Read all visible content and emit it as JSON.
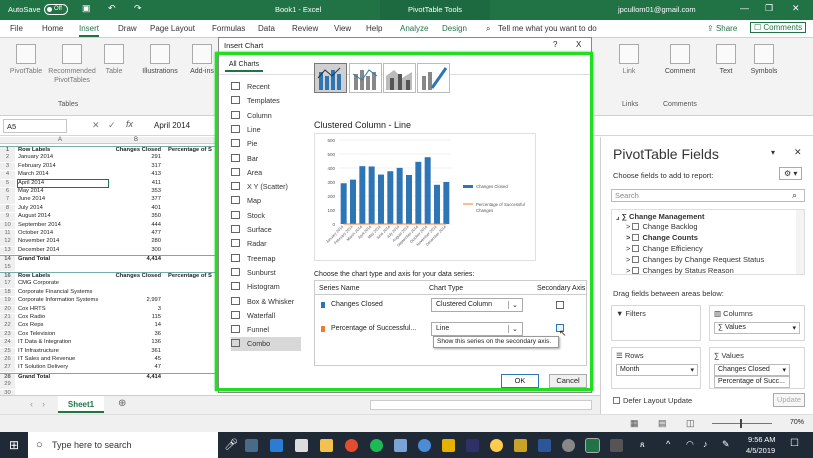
{
  "titlebar": {
    "autosave": "AutoSave",
    "toggle": "Off",
    "doc": "Book1 - Excel",
    "tools": "PivotTable Tools",
    "user": "jpcullom01@gmail.com"
  },
  "tabs": [
    "File",
    "Home",
    "Insert",
    "Draw",
    "Page Layout",
    "Formulas",
    "Data",
    "Review",
    "View",
    "Help",
    "Analyze",
    "Design"
  ],
  "active_tab": "Insert",
  "tellme": "Tell me what you want to do",
  "share": "Share",
  "comments": "Comments",
  "ribbon": {
    "pivottable": "PivotTable",
    "recommended": "Recommended PivotTables",
    "table": "Table",
    "tables_group": "Tables",
    "illustrations": "Illustrations",
    "addins": "Add-ins",
    "link": "Link",
    "comment": "Comment",
    "text": "Text",
    "symbols": "Symbols",
    "links_group": "Links",
    "comments_group": "Comments"
  },
  "formula": {
    "cell": "A5",
    "value": "April 2014"
  },
  "grid": {
    "col_a": "A",
    "col_b": "B",
    "rows": [
      {
        "n": "1",
        "a": "Row Labels",
        "b": "Changes Closed",
        "c": "Percentage of S",
        "bold": true
      },
      {
        "n": "2",
        "a": "January 2014",
        "b": "291",
        "c": ""
      },
      {
        "n": "3",
        "a": "February 2014",
        "b": "317",
        "c": ""
      },
      {
        "n": "4",
        "a": "March 2014",
        "b": "413",
        "c": ""
      },
      {
        "n": "5",
        "a": "April 2014",
        "b": "411",
        "c": ""
      },
      {
        "n": "6",
        "a": "May 2014",
        "b": "353",
        "c": ""
      },
      {
        "n": "7",
        "a": "June 2014",
        "b": "377",
        "c": ""
      },
      {
        "n": "8",
        "a": "July 2014",
        "b": "401",
        "c": ""
      },
      {
        "n": "9",
        "a": "August 2014",
        "b": "350",
        "c": ""
      },
      {
        "n": "10",
        "a": "September 2014",
        "b": "444",
        "c": ""
      },
      {
        "n": "11",
        "a": "October 2014",
        "b": "477",
        "c": ""
      },
      {
        "n": "12",
        "a": "November 2014",
        "b": "280",
        "c": ""
      },
      {
        "n": "13",
        "a": "December 2014",
        "b": "300",
        "c": ""
      },
      {
        "n": "14",
        "a": "Grand Total",
        "b": "4,414",
        "c": "",
        "bold": true
      },
      {
        "n": "15",
        "a": "",
        "b": "",
        "c": ""
      },
      {
        "n": "16",
        "a": "Row Labels",
        "b": "Changes Closed",
        "c": "Percentage of S",
        "bold": true
      },
      {
        "n": "17",
        "a": "CMG Corporate",
        "b": "",
        "c": ""
      },
      {
        "n": "18",
        "a": "Corporate Financial Systems",
        "b": "",
        "c": ""
      },
      {
        "n": "19",
        "a": "Corporate Information Systems",
        "b": "2,997",
        "c": ""
      },
      {
        "n": "20",
        "a": "Cox HRTS",
        "b": "3",
        "c": ""
      },
      {
        "n": "21",
        "a": "Cox Radio",
        "b": "115",
        "c": ""
      },
      {
        "n": "22",
        "a": "Cox Reps",
        "b": "14",
        "c": ""
      },
      {
        "n": "23",
        "a": "Cox Television",
        "b": "36",
        "c": ""
      },
      {
        "n": "24",
        "a": "IT Data & Integration",
        "b": "136",
        "c": ""
      },
      {
        "n": "25",
        "a": "IT Infrastructure",
        "b": "361",
        "c": ""
      },
      {
        "n": "26",
        "a": "IT Sales and Revenue",
        "b": "45",
        "c": ""
      },
      {
        "n": "27",
        "a": "IT Solution Delivery",
        "b": "47",
        "c": ""
      },
      {
        "n": "28",
        "a": "Grand Total",
        "b": "4,414",
        "c": "",
        "bold": true
      },
      {
        "n": "29",
        "a": "",
        "b": "",
        "c": ""
      },
      {
        "n": "30",
        "a": "",
        "b": "",
        "c": ""
      }
    ]
  },
  "sheet_tab": "Sheet1",
  "dialog": {
    "title": "Insert Chart",
    "tab": "All Charts",
    "types": [
      "Recent",
      "Templates",
      "Column",
      "Line",
      "Pie",
      "Bar",
      "Area",
      "X Y (Scatter)",
      "Map",
      "Stock",
      "Surface",
      "Radar",
      "Treemap",
      "Sunburst",
      "Histogram",
      "Box & Whisker",
      "Waterfall",
      "Funnel",
      "Combo"
    ],
    "active_type": "Combo",
    "chart_title": "Clustered Column - Line",
    "instruction": "Choose the chart type and axis for your data series:",
    "headers": {
      "name": "Series Name",
      "type": "Chart Type",
      "axis": "Secondary Axis"
    },
    "series": [
      {
        "name": "Changes Closed",
        "type": "Clustered Column",
        "color": "#2e75b6"
      },
      {
        "name": "Percentage of Successful...",
        "type": "Line",
        "color": "#ed7d31"
      }
    ],
    "tooltip": "Show this series on the secondary axis.",
    "ok": "OK",
    "cancel": "Cancel",
    "help": "?",
    "close": "X"
  },
  "chart_data": {
    "type": "bar",
    "categories": [
      "January 2014",
      "February 2014",
      "March 2014",
      "April 2014",
      "May 2014",
      "June 2014",
      "July 2014",
      "August 2014",
      "September 2014",
      "October 2014",
      "November 2014",
      "December 2014"
    ],
    "series": [
      {
        "name": "Changes Closed",
        "values": [
          291,
          317,
          413,
          411,
          353,
          377,
          401,
          350,
          444,
          477,
          280,
          300
        ]
      },
      {
        "name": "Percentage of Successful Changes",
        "values": [
          0,
          0,
          0,
          0,
          0,
          0,
          0,
          0,
          0,
          0,
          0,
          0
        ]
      }
    ],
    "ylim": [
      0,
      600
    ],
    "yticks": [
      "600",
      "500",
      "400",
      "300",
      "200",
      "100",
      "0"
    ],
    "legend": [
      "Changes Closed",
      "Percentage of Successful Changes"
    ],
    "legend_position": "right",
    "colors": {
      "bar": "#2e75b6",
      "line": "#ed7d31"
    }
  },
  "pivot": {
    "title": "PivotTable Fields",
    "choose": "Choose fields to add to report:",
    "search": "Search",
    "group": "Change Management",
    "fields": [
      "Change Backlog",
      "Change Counts",
      "Change Efficiency",
      "Changes by Change Request Status",
      "Changes by Status Reason"
    ],
    "drag": "Drag fields between areas below:",
    "filters": "Filters",
    "columns": "Columns",
    "columns_val": "Values",
    "rows": "Rows",
    "rows_val": "Month",
    "values": "Values",
    "values_1": "Changes Closed",
    "values_2": "Percentage of Succ...",
    "defer": "Defer Layout Update",
    "update": "Update"
  },
  "status": {
    "zoom": "70%"
  },
  "taskbar": {
    "search": "Type here to search",
    "time": "9:56 AM",
    "date": "4/5/2019"
  }
}
